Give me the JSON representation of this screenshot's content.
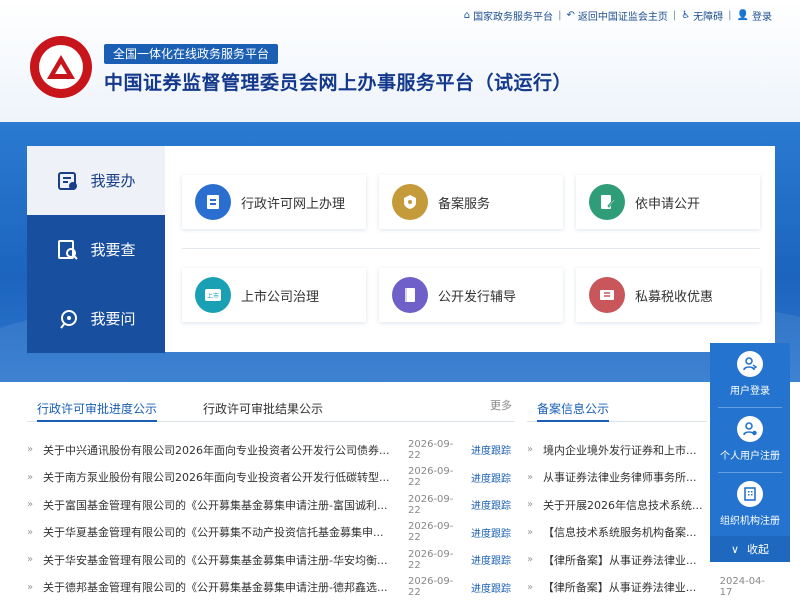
{
  "toplinks": {
    "portal": "国家政务服务平台",
    "home": "返回中国证监会主页",
    "accessible": "无障碍",
    "login": "登录"
  },
  "header": {
    "slogan": "全国一体化在线政务服务平台",
    "title": "中国证券监督管理委员会网上办事服务平台（试运行）"
  },
  "side_tabs": [
    {
      "label": "我要办",
      "icon": "service-icon"
    },
    {
      "label": "我要查",
      "icon": "search-doc-icon"
    },
    {
      "label": "我要问",
      "icon": "question-icon"
    }
  ],
  "cards": [
    {
      "label": "行政许可网上办理",
      "color": "#2a6fd0",
      "icon": "license-icon"
    },
    {
      "label": "备案服务",
      "color": "#c49a3a",
      "icon": "record-icon"
    },
    {
      "label": "依申请公开",
      "color": "#2f9d77",
      "icon": "edit-doc-icon"
    },
    {
      "label": "上市公司治理",
      "color": "#19a0b5",
      "icon": "listed-company-icon"
    },
    {
      "label": "公开发行辅导",
      "color": "#6f5fc9",
      "icon": "book-icon"
    },
    {
      "label": "私募税收优惠",
      "color": "#c8565b",
      "icon": "ticket-icon"
    }
  ],
  "list_tabs": {
    "progress": "行政许可审批进度公示",
    "result": "行政许可审批结果公示",
    "more": "更多",
    "record": "备案信息公示"
  },
  "progress_rows": [
    {
      "title": "关于中兴通讯股份有限公司2026年面向专业投资者公开发行公司债券...",
      "date": "2026-09-22",
      "track": "进度跟踪"
    },
    {
      "title": "关于南方泵业股份有限公司2026年面向专业投资者公开发行低碳转型...",
      "date": "2026-09-22",
      "track": "进度跟踪"
    },
    {
      "title": "关于富国基金管理有限公司的《公开募集基金募集申请注册-富国诚利...",
      "date": "2026-09-22",
      "track": "进度跟踪"
    },
    {
      "title": "关于华夏基金管理有限公司的《公开募集不动产投资信托基金募集申...",
      "date": "2026-09-22",
      "track": "进度跟踪"
    },
    {
      "title": "关于华安基金管理有限公司的《公开募集基金募集申请注册-华安均衡...",
      "date": "2026-09-22",
      "track": "进度跟踪"
    },
    {
      "title": "关于德邦基金管理有限公司的《公开募集基金募集申请注册-德邦鑫选...",
      "date": "2026-09-22",
      "track": "进度跟踪"
    }
  ],
  "record_rows": [
    {
      "title": "境内企业境外发行证券和上市...",
      "date": ""
    },
    {
      "title": "从事证券法律业务律师事务所...",
      "date": ""
    },
    {
      "title": "关于开展2026年信息技术系统...",
      "date": ""
    },
    {
      "title": "【信息技术系统服务机构备案...",
      "date": ""
    },
    {
      "title": "【律所备案】从事证券法律业...",
      "date": ""
    },
    {
      "title": "【律所备案】从事证券法律业...",
      "date": "2024-04-17"
    }
  ],
  "float_panel": {
    "login": "用户登录",
    "personal": "个人用户注册",
    "org": "组织机构注册",
    "collapse": "收起"
  }
}
